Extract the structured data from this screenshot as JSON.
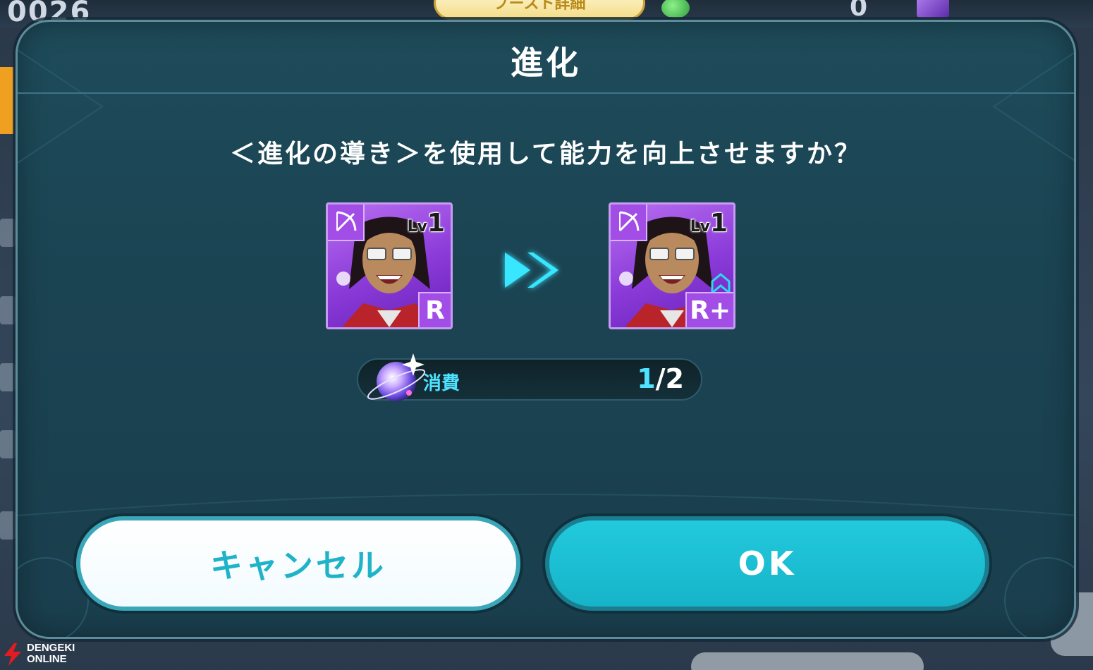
{
  "background": {
    "top_label": "0026",
    "pill_label": "ブースト詳細",
    "count": "0"
  },
  "dialog": {
    "title": "進化",
    "message": "＜進化の導き＞を使用して能力を向上させますか？"
  },
  "cards": {
    "before": {
      "level_prefix": "Lv",
      "level": "1",
      "rarity": "R"
    },
    "after": {
      "level_prefix": "Lv",
      "level": "1",
      "rarity": "R+"
    }
  },
  "consume": {
    "label": "消費",
    "current": "1",
    "separator": "/",
    "total": "2"
  },
  "buttons": {
    "cancel": "キャンセル",
    "ok": "OK"
  },
  "watermark": {
    "line1": "DENGEKI",
    "line2": "ONLINE"
  },
  "colors": {
    "accent_cyan": "#16b4c9",
    "dialog_bg": "#1b4453",
    "card_purple": "#8a3ad8"
  }
}
